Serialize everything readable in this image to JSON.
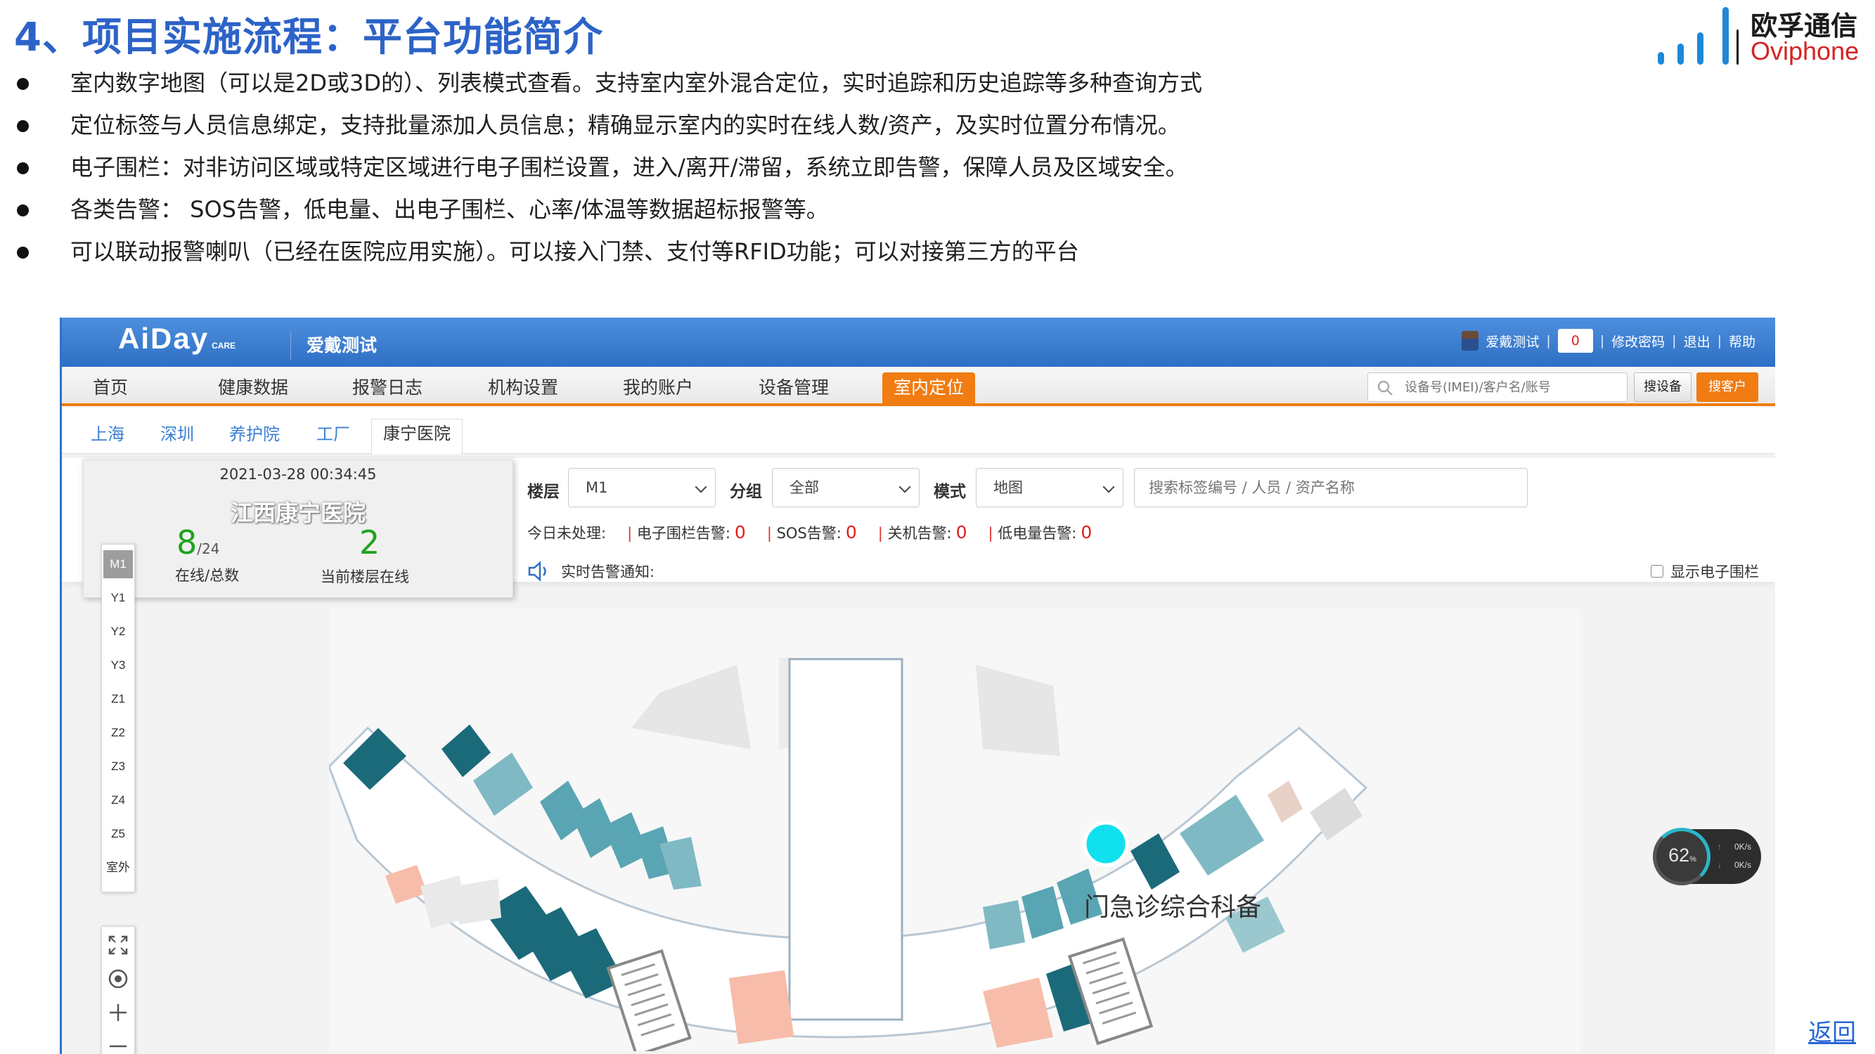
{
  "slide": {
    "title": "4、项目实施流程：平台功能简介",
    "bullets": [
      "室内数字地图（可以是2D或3D的）、列表模式查看。支持室内室外混合定位，实时追踪和历史追踪等多种查询方式",
      "定位标签与人员信息绑定，支持批量添加人员信息；精确显示室内的实时在线人数/资产，及实时位置分布情况。",
      "电子围栏：对非访问区域或特定区域进行电子围栏设置，进入/离开/滞留，系统立即告警，保障人员及区域安全。",
      "各类告警：  SOS告警，低电量、出电子围栏、心率/体温等数据超标报警等。",
      "可以联动报警喇叭（已经在医院应用实施）。可以接入门禁、支付等RFID功能；可以对接第三方的平台"
    ],
    "back_link": "返回"
  },
  "logo": {
    "zh": "欧孚通信",
    "en": "Oviphone"
  },
  "app": {
    "brand": "AiDay",
    "brand_small": "CARE",
    "org_name": "爱戴测试",
    "user": {
      "name": "爱戴测试",
      "message_count": "0",
      "change_password": "修改密码",
      "logout": "退出",
      "help": "帮助",
      "separator": "|"
    },
    "menu": [
      "首页",
      "健康数据",
      "报警日志",
      "机构设置",
      "我的账户",
      "设备管理",
      "室内定位"
    ],
    "active_menu": "室内定位",
    "search": {
      "placeholder": "设备号(IMEI)/客户名/账号",
      "search_device": "搜设备",
      "search_customer": "搜客户"
    },
    "site_tabs": [
      "上海",
      "深圳",
      "养护院",
      "工厂",
      "康宁医院"
    ],
    "active_site": "康宁医院",
    "info_card": {
      "time": "2021-03-28 00:34:45",
      "org": "江西康宁医院",
      "online": "8",
      "total": "/24",
      "online_total_label": "在线/总数",
      "floor_online": "2",
      "floor_online_label": "当前楼层在线"
    },
    "filters": {
      "floor_label": "楼层",
      "floor_value": "M1",
      "group_label": "分组",
      "group_value": "全部",
      "mode_label": "模式",
      "mode_value": "地图",
      "tag_search_placeholder": "搜索标签编号 / 人员 / 资产名称"
    },
    "alarms": {
      "today_label": "今日未处理:",
      "items": [
        {
          "label": "电子围栏告警:",
          "count": "0"
        },
        {
          "label": "SOS告警:",
          "count": "0"
        },
        {
          "label": "关机告警:",
          "count": "0"
        },
        {
          "label": "低电量告警:",
          "count": "0"
        }
      ]
    },
    "realtime_notify": "实时告警通知:",
    "show_fence": "显示电子围栏",
    "floors": [
      "M1",
      "Y1",
      "Y2",
      "Y3",
      "Z1",
      "Z2",
      "Z3",
      "Z4",
      "Z5",
      "室外"
    ],
    "active_floor": "M1",
    "map_label": "门急诊综合科备",
    "speed": {
      "percent": "62",
      "percent_unit": "%",
      "up": "0K/s",
      "down": "0K/s"
    },
    "colors": {
      "header_blue": "#2f6fc4",
      "menu_orange": "#f07c12",
      "alarm_red": "#e02020",
      "room_teal_dark": "#1b6a7a",
      "room_teal_light": "#7fb9c4",
      "room_salmon": "#f7bdaa",
      "marker_cyan": "#10e0ee"
    }
  }
}
